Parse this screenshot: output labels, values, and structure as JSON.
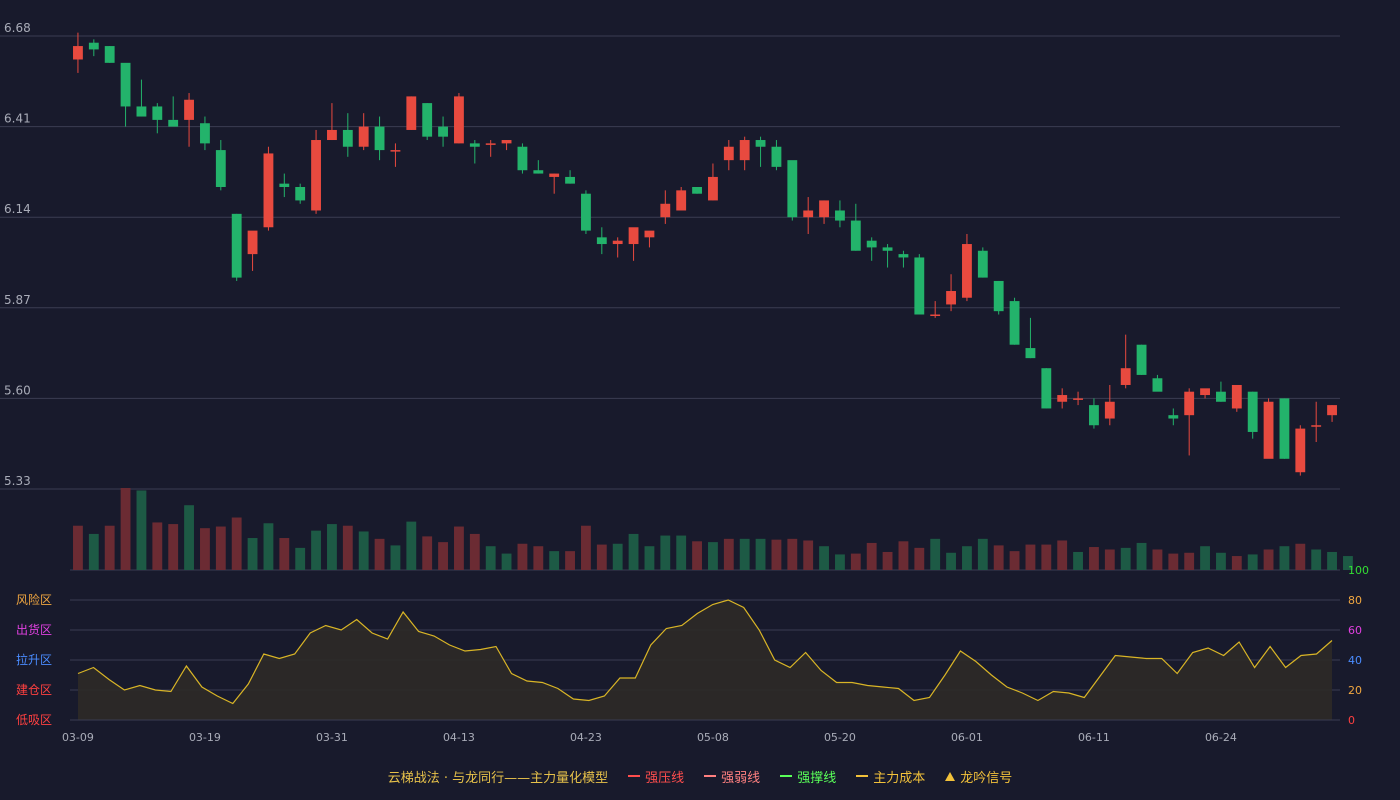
{
  "chart_data": {
    "type": "candlestick",
    "price_axis": {
      "ticks": [
        "6.68",
        "6.41",
        "6.14",
        "5.87",
        "5.60",
        "5.33"
      ],
      "range": [
        5.33,
        6.68
      ]
    },
    "indicator_axis": {
      "ticks": [
        "100",
        "80",
        "60",
        "40",
        "20",
        "0"
      ],
      "range": [
        0,
        100
      ]
    },
    "zones": [
      "风险区",
      "出货区",
      "拉升区",
      "建仓区",
      "低吸区"
    ],
    "x_labels": [
      {
        "label": "03-09",
        "index": 0
      },
      {
        "label": "03-19",
        "index": 8
      },
      {
        "label": "03-31",
        "index": 16
      },
      {
        "label": "04-13",
        "index": 24
      },
      {
        "label": "04-23",
        "index": 32
      },
      {
        "label": "05-08",
        "index": 40
      },
      {
        "label": "05-20",
        "index": 48
      },
      {
        "label": "06-01",
        "index": 56
      },
      {
        "label": "06-11",
        "index": 64
      },
      {
        "label": "06-24",
        "index": 72
      }
    ],
    "candles": [
      [
        6.61,
        6.69,
        6.57,
        6.65
      ],
      [
        6.66,
        6.67,
        6.62,
        6.64
      ],
      [
        6.65,
        6.65,
        6.6,
        6.6
      ],
      [
        6.6,
        6.58,
        6.41,
        6.47
      ],
      [
        6.47,
        6.55,
        6.44,
        6.44
      ],
      [
        6.47,
        6.48,
        6.39,
        6.43
      ],
      [
        6.43,
        6.5,
        6.43,
        6.41
      ],
      [
        6.43,
        6.51,
        6.35,
        6.49
      ],
      [
        6.42,
        6.44,
        6.34,
        6.36
      ],
      [
        6.34,
        6.37,
        6.22,
        6.23
      ],
      [
        6.15,
        6.15,
        5.95,
        5.96
      ],
      [
        6.03,
        6.06,
        5.98,
        6.1
      ],
      [
        6.11,
        6.35,
        6.1,
        6.33
      ],
      [
        6.24,
        6.27,
        6.2,
        6.23
      ],
      [
        6.23,
        6.24,
        6.18,
        6.19
      ],
      [
        6.16,
        6.4,
        6.15,
        6.37
      ],
      [
        6.37,
        6.48,
        6.37,
        6.4
      ],
      [
        6.4,
        6.45,
        6.32,
        6.35
      ],
      [
        6.35,
        6.45,
        6.34,
        6.41
      ],
      [
        6.41,
        6.44,
        6.31,
        6.34
      ],
      [
        6.34,
        6.36,
        6.29,
        6.34
      ],
      [
        6.4,
        6.5,
        6.4,
        6.5
      ],
      [
        6.48,
        6.48,
        6.37,
        6.38
      ],
      [
        6.41,
        6.44,
        6.35,
        6.38
      ],
      [
        6.36,
        6.51,
        6.36,
        6.5
      ],
      [
        6.36,
        6.37,
        6.3,
        6.35
      ],
      [
        6.36,
        6.37,
        6.32,
        6.36
      ],
      [
        6.36,
        6.37,
        6.34,
        6.37
      ],
      [
        6.35,
        6.36,
        6.27,
        6.28
      ],
      [
        6.28,
        6.31,
        6.27,
        6.27
      ],
      [
        6.26,
        6.27,
        6.21,
        6.27
      ],
      [
        6.26,
        6.28,
        6.24,
        6.24
      ],
      [
        6.21,
        6.22,
        6.09,
        6.1
      ],
      [
        6.08,
        6.11,
        6.03,
        6.06
      ],
      [
        6.06,
        6.08,
        6.02,
        6.07
      ],
      [
        6.06,
        6.1,
        6.01,
        6.11
      ],
      [
        6.08,
        6.09,
        6.05,
        6.1
      ],
      [
        6.14,
        6.22,
        6.12,
        6.18
      ],
      [
        6.16,
        6.23,
        6.17,
        6.22
      ],
      [
        6.23,
        6.23,
        6.21,
        6.21
      ],
      [
        6.19,
        6.3,
        6.19,
        6.26
      ],
      [
        6.31,
        6.37,
        6.28,
        6.35
      ],
      [
        6.31,
        6.38,
        6.28,
        6.37
      ],
      [
        6.37,
        6.38,
        6.29,
        6.35
      ],
      [
        6.35,
        6.37,
        6.28,
        6.29
      ],
      [
        6.31,
        6.29,
        6.13,
        6.14
      ],
      [
        6.14,
        6.2,
        6.09,
        6.16
      ],
      [
        6.14,
        6.19,
        6.12,
        6.19
      ],
      [
        6.16,
        6.19,
        6.11,
        6.13
      ],
      [
        6.13,
        6.18,
        6.04,
        6.04
      ],
      [
        6.07,
        6.08,
        6.01,
        6.05
      ],
      [
        6.05,
        6.06,
        5.99,
        6.04
      ],
      [
        6.03,
        6.04,
        5.99,
        6.02
      ],
      [
        6.02,
        6.03,
        5.85,
        5.85
      ],
      [
        5.85,
        5.89,
        5.84,
        5.85
      ],
      [
        5.88,
        5.97,
        5.86,
        5.92
      ],
      [
        5.9,
        6.09,
        5.89,
        6.06
      ],
      [
        6.04,
        6.05,
        5.96,
        5.96
      ],
      [
        5.95,
        5.95,
        5.85,
        5.86
      ],
      [
        5.89,
        5.9,
        5.76,
        5.76
      ],
      [
        5.75,
        5.84,
        5.72,
        5.72
      ],
      [
        5.69,
        5.69,
        5.57,
        5.57
      ],
      [
        5.59,
        5.63,
        5.57,
        5.61
      ],
      [
        5.6,
        5.62,
        5.58,
        5.6
      ],
      [
        5.58,
        5.6,
        5.51,
        5.52
      ],
      [
        5.54,
        5.64,
        5.52,
        5.59
      ],
      [
        5.64,
        5.79,
        5.63,
        5.69
      ],
      [
        5.76,
        5.76,
        5.67,
        5.67
      ],
      [
        5.66,
        5.67,
        5.63,
        5.62
      ],
      [
        5.55,
        5.57,
        5.52,
        5.54
      ],
      [
        5.55,
        5.63,
        5.43,
        5.62
      ],
      [
        5.61,
        5.62,
        5.6,
        5.63
      ],
      [
        5.62,
        5.65,
        5.59,
        5.59
      ],
      [
        5.57,
        5.63,
        5.56,
        5.64
      ],
      [
        5.62,
        5.62,
        5.48,
        5.5
      ],
      [
        5.42,
        5.6,
        5.43,
        5.59
      ],
      [
        5.6,
        5.6,
        5.42,
        5.42
      ],
      [
        5.38,
        5.52,
        5.37,
        5.51
      ],
      [
        5.52,
        5.59,
        5.47,
        5.52
      ],
      [
        5.55,
        5.58,
        5.53,
        5.58
      ]
    ],
    "volume": [
      [
        0.54,
        "up"
      ],
      [
        0.44,
        "down"
      ],
      [
        0.54,
        "up"
      ],
      [
        1.0,
        "up"
      ],
      [
        0.97,
        "down"
      ],
      [
        0.58,
        "up"
      ],
      [
        0.56,
        "up"
      ],
      [
        0.79,
        "down"
      ],
      [
        0.51,
        "up"
      ],
      [
        0.53,
        "up"
      ],
      [
        0.64,
        "up"
      ],
      [
        0.39,
        "down"
      ],
      [
        0.57,
        "down"
      ],
      [
        0.39,
        "up"
      ],
      [
        0.27,
        "down"
      ],
      [
        0.48,
        "down"
      ],
      [
        0.56,
        "down"
      ],
      [
        0.54,
        "up"
      ],
      [
        0.47,
        "down"
      ],
      [
        0.38,
        "up"
      ],
      [
        0.3,
        "down"
      ],
      [
        0.59,
        "down"
      ],
      [
        0.41,
        "up"
      ],
      [
        0.34,
        "up"
      ],
      [
        0.53,
        "up"
      ],
      [
        0.44,
        "up"
      ],
      [
        0.29,
        "down"
      ],
      [
        0.2,
        "down"
      ],
      [
        0.32,
        "up"
      ],
      [
        0.29,
        "up"
      ],
      [
        0.23,
        "down"
      ],
      [
        0.23,
        "up"
      ],
      [
        0.54,
        "up"
      ],
      [
        0.31,
        "up"
      ],
      [
        0.32,
        "down"
      ],
      [
        0.44,
        "down"
      ],
      [
        0.29,
        "down"
      ],
      [
        0.42,
        "down"
      ],
      [
        0.42,
        "down"
      ],
      [
        0.35,
        "up"
      ],
      [
        0.34,
        "down"
      ],
      [
        0.38,
        "up"
      ],
      [
        0.38,
        "down"
      ],
      [
        0.38,
        "down"
      ],
      [
        0.37,
        "up"
      ],
      [
        0.38,
        "up"
      ],
      [
        0.36,
        "up"
      ],
      [
        0.29,
        "down"
      ],
      [
        0.19,
        "down"
      ],
      [
        0.2,
        "up"
      ],
      [
        0.33,
        "up"
      ],
      [
        0.22,
        "up"
      ],
      [
        0.35,
        "up"
      ],
      [
        0.27,
        "up"
      ],
      [
        0.38,
        "down"
      ],
      [
        0.21,
        "down"
      ],
      [
        0.29,
        "down"
      ],
      [
        0.38,
        "down"
      ],
      [
        0.3,
        "up"
      ],
      [
        0.23,
        "up"
      ],
      [
        0.31,
        "up"
      ],
      [
        0.31,
        "up"
      ],
      [
        0.36,
        "up"
      ],
      [
        0.22,
        "down"
      ],
      [
        0.28,
        "up"
      ],
      [
        0.25,
        "up"
      ],
      [
        0.27,
        "down"
      ],
      [
        0.33,
        "down"
      ],
      [
        0.25,
        "up"
      ],
      [
        0.2,
        "up"
      ],
      [
        0.21,
        "up"
      ],
      [
        0.29,
        "down"
      ],
      [
        0.21,
        "down"
      ],
      [
        0.17,
        "up"
      ],
      [
        0.19,
        "down"
      ],
      [
        0.25,
        "up"
      ],
      [
        0.29,
        "down"
      ],
      [
        0.32,
        "up"
      ],
      [
        0.25,
        "down"
      ],
      [
        0.22,
        "down"
      ],
      [
        0.17,
        "down"
      ]
    ],
    "indicator": [
      31,
      35,
      27,
      20,
      23,
      20,
      19,
      36,
      22,
      16,
      11,
      24,
      44,
      41,
      44,
      58,
      63,
      60,
      67,
      58,
      54,
      72,
      59,
      56,
      50,
      46,
      47,
      49,
      31,
      26,
      25,
      21,
      14,
      13,
      16,
      28,
      28,
      50,
      61,
      63,
      71,
      77,
      80,
      75,
      60,
      40,
      35,
      45,
      33,
      25,
      25,
      23,
      22,
      21,
      13,
      15,
      30,
      46,
      39,
      30,
      22,
      18,
      13,
      19,
      18,
      15,
      29,
      43,
      42,
      41,
      41,
      31,
      45,
      48,
      43,
      52,
      35,
      49,
      35,
      43,
      44,
      53
    ],
    "legend": {
      "title": "云梯战法 · 与龙同行——主力量化模型",
      "items": [
        {
          "label": "强压线",
          "color": "#ff4d4d",
          "style": "solid"
        },
        {
          "label": "强弱线",
          "color": "#ff8080",
          "style": "dashed"
        },
        {
          "label": "强撑线",
          "color": "#59ff59",
          "style": "solid"
        },
        {
          "label": "主力成本",
          "color": "#f2c13a",
          "style": "dashed"
        },
        {
          "label": "龙吟信号",
          "color": "#f2c13a",
          "style": "triangle"
        }
      ]
    },
    "colors": {
      "background": "#181a2c",
      "up": "#e84a3f",
      "down": "#23b36b",
      "vol_up": "#6b2b33",
      "vol_down": "#1d5a45",
      "indicator_line": "#d9b526",
      "indicator_fill": "#2e2a27",
      "grid": "#3a3c52",
      "tick_text": "#a9acb8",
      "zone_colors": [
        "#f0a640",
        "#e040e0",
        "#4a8cff",
        "#ff4040",
        "#ff4040"
      ],
      "indicator_tick_colors": [
        "#33dd33",
        "#f0a640",
        "#e040e0",
        "#4a8cff",
        "#f0a640",
        "#ff4040"
      ]
    }
  }
}
